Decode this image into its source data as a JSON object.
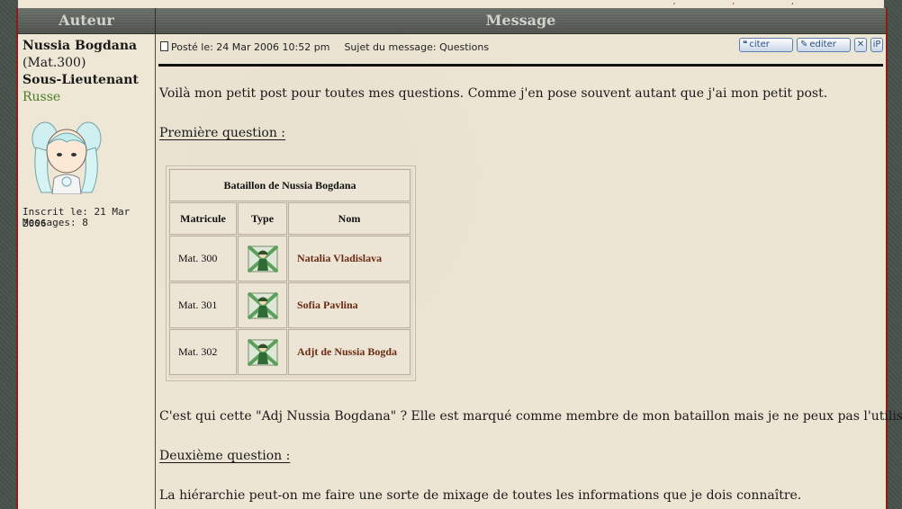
{
  "header": {
    "author": "Auteur",
    "message": "Message"
  },
  "author": {
    "name": "Nussia Bogdana",
    "matricule": "(Mat.300)",
    "rank": "Sous-Lieutenant",
    "nation": "Russe",
    "joined": "Inscrit le: 21 Mar 2006",
    "posts": "Messages: 8"
  },
  "post": {
    "posted": "Posté le: 24 Mar 2006 10:52 pm",
    "subject": "Sujet du message: Questions",
    "buttons": {
      "quote": "citer",
      "edit": "editer",
      "delete_icon": "close-icon",
      "ip": "iP"
    },
    "intro": "Voilà mon petit post pour toutes mes questions. Comme j'en pose souvent autant que j'ai mon petit post.",
    "q1_heading": "Première question :",
    "q1_text": "C'est qui cette \"Adj Nussia Bogdana\" ? Elle est marqué comme membre de mon bataillon mais je ne peux pas l'utiliser...",
    "q2_heading": "Deuxième question :",
    "q2_text": "La hiérarchie peut-on me faire une sorte de mixage de toutes les informations que je dois connaître."
  },
  "battalion": {
    "title": "Bataillon de Nussia Bogdana",
    "columns": [
      "Matricule",
      "Type",
      "Nom"
    ],
    "rows": [
      {
        "mat": "Mat. 300",
        "type": "soldier-icon",
        "name": "Natalia Vladislava"
      },
      {
        "mat": "Mat. 301",
        "type": "soldier-icon",
        "name": "Sofia Pavlina"
      },
      {
        "mat": "Mat. 302",
        "type": "soldier-icon",
        "name": "Adjt de Nussia Bogda"
      }
    ]
  },
  "colors": {
    "border": "#8b1e14",
    "nation": "#4a7a2a",
    "unit_name": "#6b2b12"
  }
}
